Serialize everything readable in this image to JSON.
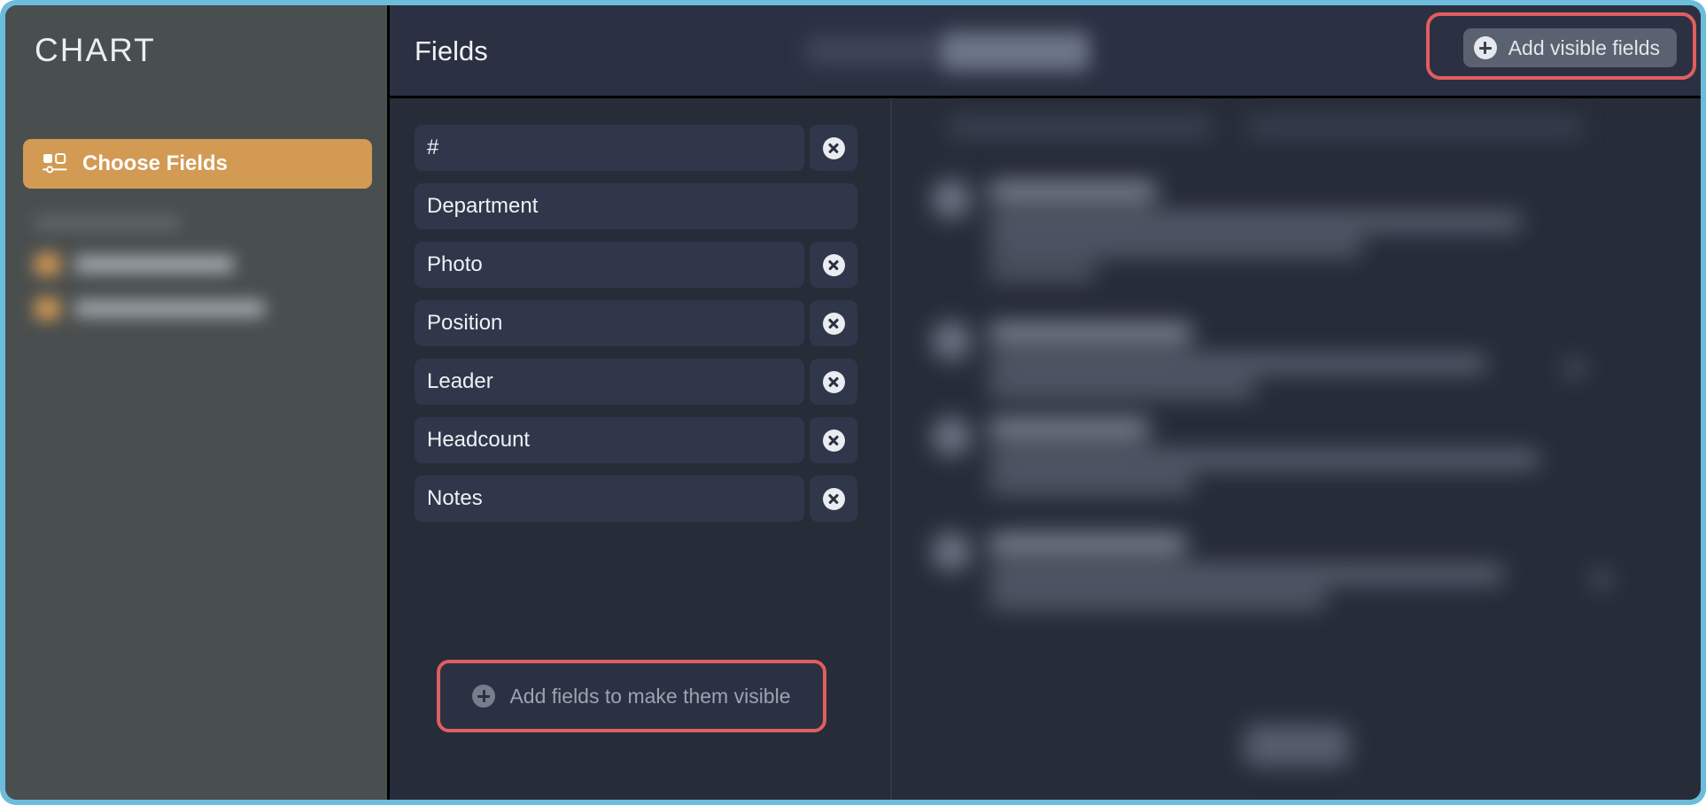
{
  "window": {
    "frame_color": "#6cbcdb",
    "sidebar_bg": "#494e4e",
    "panel_bg": "#272c39"
  },
  "sidebar": {
    "app_title": "CHART",
    "primary_action": {
      "label": "Choose Fields",
      "icon": "choose-fields-icon",
      "accent_color": "#d39a54",
      "active": true
    },
    "obscured_items": [
      {
        "swatch_color": "#d39a54"
      },
      {
        "swatch_color": "#d39a54"
      }
    ]
  },
  "header": {
    "title": "Fields",
    "segmented_control": {
      "obscured": true,
      "segments": 2,
      "selected_index": 1
    },
    "add_visible_fields": {
      "label": "Add visible fields",
      "icon": "plus-circle-icon",
      "highlighted": true,
      "highlight_color": "#e05e60"
    }
  },
  "fields_panel": {
    "rows": [
      {
        "name": "#",
        "removable": true,
        "remove_icon": "close-circle-icon"
      },
      {
        "name": "Department",
        "removable": false,
        "remove_icon": ""
      },
      {
        "name": "Photo",
        "removable": true,
        "remove_icon": "close-circle-icon"
      },
      {
        "name": "Position",
        "removable": true,
        "remove_icon": "close-circle-icon"
      },
      {
        "name": "Leader",
        "removable": true,
        "remove_icon": "close-circle-icon"
      },
      {
        "name": "Headcount",
        "removable": true,
        "remove_icon": "close-circle-icon"
      },
      {
        "name": "Notes",
        "removable": true,
        "remove_icon": "close-circle-icon"
      }
    ],
    "add_fields_cta": {
      "label": "Add fields to make them visible",
      "icon": "plus-circle-icon",
      "highlighted": true,
      "highlight_color": "#e05e60"
    }
  },
  "preview_panel": {
    "obscured": true,
    "list_items": [
      {
        "obscured": true
      },
      {
        "obscured": true
      },
      {
        "obscured": true
      },
      {
        "obscured": true
      }
    ],
    "footer_button": {
      "obscured": true
    }
  }
}
